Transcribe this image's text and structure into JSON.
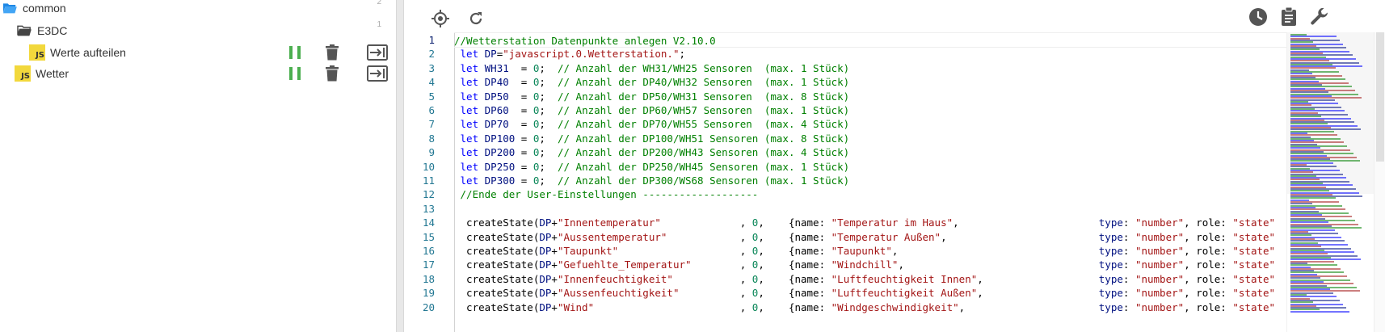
{
  "tree": {
    "items": [
      {
        "label": "common",
        "type": "folder-open",
        "count": "2",
        "indent": 0
      },
      {
        "label": "E3DC",
        "type": "folder-open",
        "count": "1",
        "indent": 1
      },
      {
        "label": "Werte aufteilen",
        "type": "script",
        "count": "",
        "indent": 2
      },
      {
        "label": "Wetter",
        "type": "script",
        "count": "",
        "indent": 1
      }
    ],
    "js_badge": "JS"
  },
  "toolbar": {
    "left_icons": [
      "locate-icon",
      "refresh-icon"
    ],
    "right_icons": [
      "history-icon",
      "clipboard-icon",
      "wrench-icon"
    ]
  },
  "editor": {
    "line_numbers": [
      "1",
      "2",
      "3",
      "4",
      "5",
      "6",
      "7",
      "8",
      "9",
      "10",
      "11",
      "12",
      "13",
      "14",
      "15",
      "16",
      "17",
      "18",
      "19",
      "20"
    ],
    "lines": [
      [
        [
          "cm",
          "//Wetterstation Datenpunkte anlegen V2.10.0"
        ]
      ],
      [
        [
          "pl",
          " "
        ],
        [
          "kw",
          "let"
        ],
        [
          "pl",
          " "
        ],
        [
          "id",
          "DP"
        ],
        [
          "pl",
          "="
        ],
        [
          "str",
          "\"javascript.0.Wetterstation.\""
        ],
        [
          "pl",
          ";"
        ]
      ],
      [
        [
          "pl",
          " "
        ],
        [
          "kw",
          "let"
        ],
        [
          "pl",
          " "
        ],
        [
          "id",
          "WH31"
        ],
        [
          "pl",
          "  = "
        ],
        [
          "num",
          "0"
        ],
        [
          "pl",
          ";  "
        ],
        [
          "cm",
          "// Anzahl der WH31/WH25 Sensoren  (max. 1 Stück)"
        ]
      ],
      [
        [
          "pl",
          " "
        ],
        [
          "kw",
          "let"
        ],
        [
          "pl",
          " "
        ],
        [
          "id",
          "DP40"
        ],
        [
          "pl",
          "  = "
        ],
        [
          "num",
          "0"
        ],
        [
          "pl",
          ";  "
        ],
        [
          "cm",
          "// Anzahl der DP40/WH32 Sensoren  (max. 1 Stück)"
        ]
      ],
      [
        [
          "pl",
          " "
        ],
        [
          "kw",
          "let"
        ],
        [
          "pl",
          " "
        ],
        [
          "id",
          "DP50"
        ],
        [
          "pl",
          "  = "
        ],
        [
          "num",
          "0"
        ],
        [
          "pl",
          ";  "
        ],
        [
          "cm",
          "// Anzahl der DP50/WH31 Sensoren  (max. 8 Stück)"
        ]
      ],
      [
        [
          "pl",
          " "
        ],
        [
          "kw",
          "let"
        ],
        [
          "pl",
          " "
        ],
        [
          "id",
          "DP60"
        ],
        [
          "pl",
          "  = "
        ],
        [
          "num",
          "0"
        ],
        [
          "pl",
          ";  "
        ],
        [
          "cm",
          "// Anzahl der DP60/WH57 Sensoren  (max. 1 Stück)"
        ]
      ],
      [
        [
          "pl",
          " "
        ],
        [
          "kw",
          "let"
        ],
        [
          "pl",
          " "
        ],
        [
          "id",
          "DP70"
        ],
        [
          "pl",
          "  = "
        ],
        [
          "num",
          "0"
        ],
        [
          "pl",
          ";  "
        ],
        [
          "cm",
          "// Anzahl der DP70/WH55 Sensoren  (max. 4 Stück)"
        ]
      ],
      [
        [
          "pl",
          " "
        ],
        [
          "kw",
          "let"
        ],
        [
          "pl",
          " "
        ],
        [
          "id",
          "DP100"
        ],
        [
          "pl",
          " = "
        ],
        [
          "num",
          "0"
        ],
        [
          "pl",
          ";  "
        ],
        [
          "cm",
          "// Anzahl der DP100/WH51 Sensoren (max. 8 Stück)"
        ]
      ],
      [
        [
          "pl",
          " "
        ],
        [
          "kw",
          "let"
        ],
        [
          "pl",
          " "
        ],
        [
          "id",
          "DP200"
        ],
        [
          "pl",
          " = "
        ],
        [
          "num",
          "0"
        ],
        [
          "pl",
          ";  "
        ],
        [
          "cm",
          "// Anzahl der DP200/WH43 Sensoren (max. 4 Stück)"
        ]
      ],
      [
        [
          "pl",
          " "
        ],
        [
          "kw",
          "let"
        ],
        [
          "pl",
          " "
        ],
        [
          "id",
          "DP250"
        ],
        [
          "pl",
          " = "
        ],
        [
          "num",
          "0"
        ],
        [
          "pl",
          ";  "
        ],
        [
          "cm",
          "// Anzahl der DP250/WH45 Sensoren (max. 1 Stück)"
        ]
      ],
      [
        [
          "pl",
          " "
        ],
        [
          "kw",
          "let"
        ],
        [
          "pl",
          " "
        ],
        [
          "id",
          "DP300"
        ],
        [
          "pl",
          " = "
        ],
        [
          "num",
          "0"
        ],
        [
          "pl",
          ";  "
        ],
        [
          "cm",
          "// Anzahl der DP300/WS68 Sensoren (max. 1 Stück)"
        ]
      ],
      [
        [
          "pl",
          " "
        ],
        [
          "cm",
          "//Ende der User-Einstellungen -------------------"
        ]
      ],
      [
        [
          "pl",
          ""
        ]
      ],
      [
        [
          "pl",
          "  createState("
        ],
        [
          "id",
          "DP"
        ],
        [
          "pl",
          "+"
        ],
        [
          "str",
          "\"Innentemperatur\""
        ],
        [
          "pl",
          "             , "
        ],
        [
          "num",
          "0"
        ],
        [
          "pl",
          ",    {name: "
        ],
        [
          "str",
          "\"Temperatur im Haus\""
        ],
        [
          "pl",
          ",                       "
        ],
        [
          "id",
          "type"
        ],
        [
          "pl",
          ": "
        ],
        [
          "str",
          "\"number\""
        ],
        [
          "pl",
          ", role: "
        ],
        [
          "str",
          "\"state\""
        ]
      ],
      [
        [
          "pl",
          "  createState("
        ],
        [
          "id",
          "DP"
        ],
        [
          "pl",
          "+"
        ],
        [
          "str",
          "\"Aussentemperatur\""
        ],
        [
          "pl",
          "            , "
        ],
        [
          "num",
          "0"
        ],
        [
          "pl",
          ",    {name: "
        ],
        [
          "str",
          "\"Temperatur Außen\""
        ],
        [
          "pl",
          ",                         "
        ],
        [
          "id",
          "type"
        ],
        [
          "pl",
          ": "
        ],
        [
          "str",
          "\"number\""
        ],
        [
          "pl",
          ", role: "
        ],
        [
          "str",
          "\"state\""
        ]
      ],
      [
        [
          "pl",
          "  createState("
        ],
        [
          "id",
          "DP"
        ],
        [
          "pl",
          "+"
        ],
        [
          "str",
          "\"Taupunkt\""
        ],
        [
          "pl",
          "                    , "
        ],
        [
          "num",
          "0"
        ],
        [
          "pl",
          ",    {name: "
        ],
        [
          "str",
          "\"Taupunkt\""
        ],
        [
          "pl",
          ",                                 "
        ],
        [
          "id",
          "type"
        ],
        [
          "pl",
          ": "
        ],
        [
          "str",
          "\"number\""
        ],
        [
          "pl",
          ", role: "
        ],
        [
          "str",
          "\"state\""
        ]
      ],
      [
        [
          "pl",
          "  createState("
        ],
        [
          "id",
          "DP"
        ],
        [
          "pl",
          "+"
        ],
        [
          "str",
          "\"Gefuehlte_Temperatur\""
        ],
        [
          "pl",
          "        , "
        ],
        [
          "num",
          "0"
        ],
        [
          "pl",
          ",    {name: "
        ],
        [
          "str",
          "\"Windchill\""
        ],
        [
          "pl",
          ",                                "
        ],
        [
          "id",
          "type"
        ],
        [
          "pl",
          ": "
        ],
        [
          "str",
          "\"number\""
        ],
        [
          "pl",
          ", role: "
        ],
        [
          "str",
          "\"state\""
        ]
      ],
      [
        [
          "pl",
          "  createState("
        ],
        [
          "id",
          "DP"
        ],
        [
          "pl",
          "+"
        ],
        [
          "str",
          "\"Innenfeuchtigkeit\""
        ],
        [
          "pl",
          "           , "
        ],
        [
          "num",
          "0"
        ],
        [
          "pl",
          ",    {name: "
        ],
        [
          "str",
          "\"Luftfeuchtigkeit Innen\""
        ],
        [
          "pl",
          ",                   "
        ],
        [
          "id",
          "type"
        ],
        [
          "pl",
          ": "
        ],
        [
          "str",
          "\"number\""
        ],
        [
          "pl",
          ", role: "
        ],
        [
          "str",
          "\"state\""
        ]
      ],
      [
        [
          "pl",
          "  createState("
        ],
        [
          "id",
          "DP"
        ],
        [
          "pl",
          "+"
        ],
        [
          "str",
          "\"Aussenfeuchtigkeit\""
        ],
        [
          "pl",
          "          , "
        ],
        [
          "num",
          "0"
        ],
        [
          "pl",
          ",    {name: "
        ],
        [
          "str",
          "\"Luftfeuchtigkeit Außen\""
        ],
        [
          "pl",
          ",                   "
        ],
        [
          "id",
          "type"
        ],
        [
          "pl",
          ": "
        ],
        [
          "str",
          "\"number\""
        ],
        [
          "pl",
          ", role: "
        ],
        [
          "str",
          "\"state\""
        ]
      ],
      [
        [
          "pl",
          "  createState("
        ],
        [
          "id",
          "DP"
        ],
        [
          "pl",
          "+"
        ],
        [
          "str",
          "\"Wind\""
        ],
        [
          "pl",
          "                        , "
        ],
        [
          "num",
          "0"
        ],
        [
          "pl",
          ",    {name: "
        ],
        [
          "str",
          "\"Windgeschwindigkeit\""
        ],
        [
          "pl",
          ",                      "
        ],
        [
          "id",
          "type"
        ],
        [
          "pl",
          ": "
        ],
        [
          "str",
          "\"number\""
        ],
        [
          "pl",
          ", role: "
        ],
        [
          "str",
          "\"state\""
        ]
      ]
    ]
  },
  "colors": {
    "pause": "#4caf50",
    "js_badge": "#f2d83c",
    "keyword": "#0000ff",
    "identifier": "#001080",
    "string": "#a31515",
    "comment": "#008000",
    "number": "#098658"
  }
}
